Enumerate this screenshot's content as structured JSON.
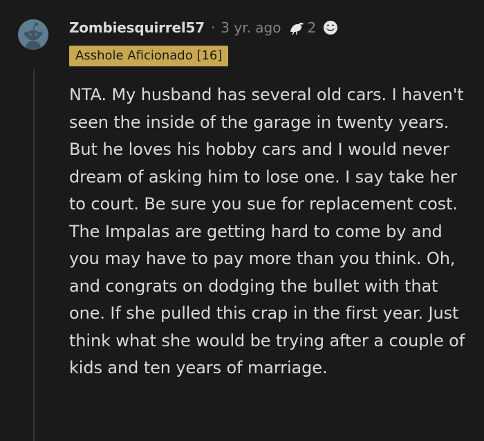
{
  "comment": {
    "username": "Zombiesquirrel57",
    "separator": "·",
    "age": "3 yr. ago",
    "award_count": "2",
    "flair": "Asshole Aficionado [16]",
    "body": "NTA. My husband has several old cars. I haven't seen the inside of the garage in twenty years. But he loves his hobby cars and I would never dream of asking him to lose one. I say take her to court. Be sure you sue for replacement cost. The Impalas are getting hard to come by and you may have to pay more than you think. Oh, and congrats on dodging the bullet with that one. If she pulled this crap in the first year. Just think what she would be trying after a couple of kids and ten years of marriage."
  },
  "icons": {
    "avatar": "snoo-avatar-icon",
    "award_1": "helpful-award-icon",
    "award_2": "wholesome-award-icon"
  },
  "colors": {
    "background": "#1a1a1b",
    "text": "#d7dadc",
    "meta": "#818384",
    "flair_bg": "#c8a951",
    "avatar_bg": "#5e7d8f"
  }
}
